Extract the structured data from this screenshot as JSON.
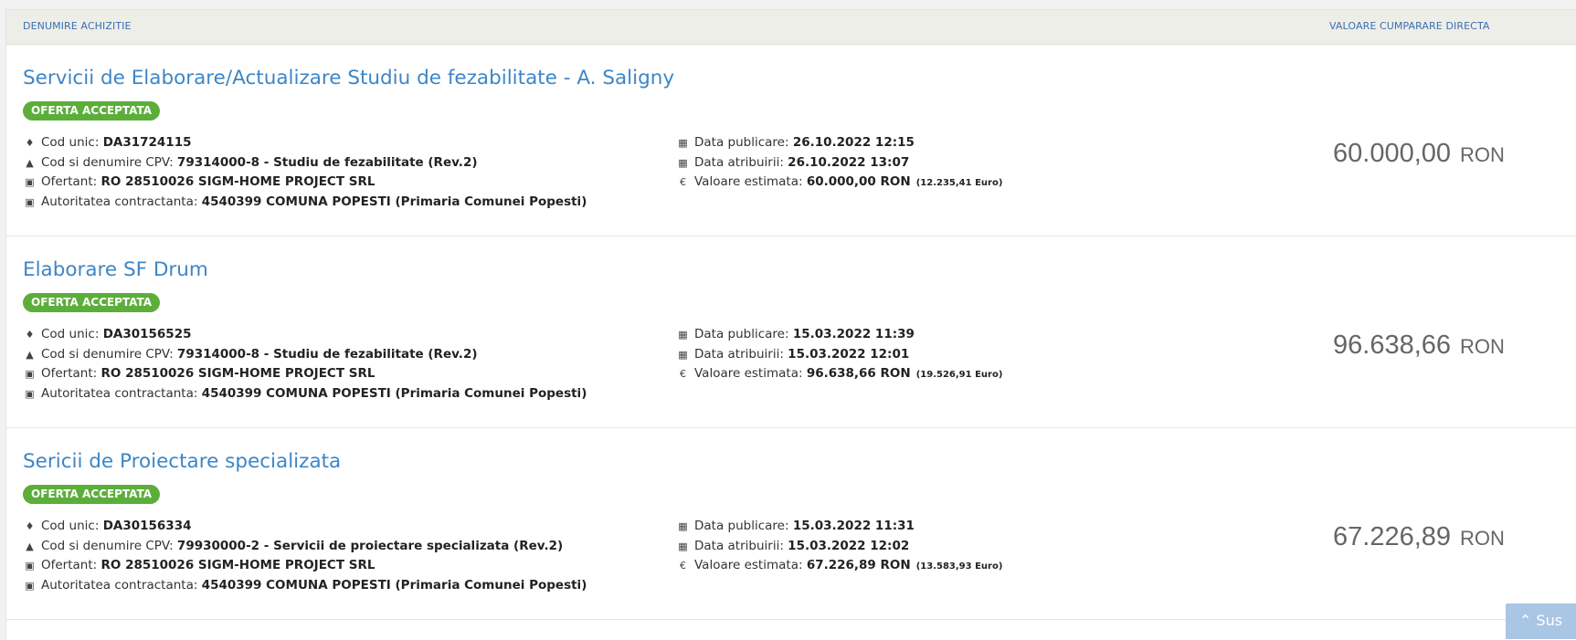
{
  "header": {
    "col_name": "DENUMIRE ACHIZITIE",
    "col_value": "VALOARE CUMPARARE DIRECTA"
  },
  "labels": {
    "cod_unic": "Cod unic:",
    "cpv": "Cod si denumire CPV:",
    "ofertant": "Ofertant:",
    "autoritate": "Autoritatea contractanta:",
    "data_publicare": "Data publicare:",
    "data_atribuirii": "Data atribuirii:",
    "valoare_estimata": "Valoare estimata:",
    "euro": "Euro"
  },
  "items": [
    {
      "title": "Servicii de Elaborare/Actualizare Studiu de fezabilitate - A. Saligny",
      "status": "OFERTA ACCEPTATA",
      "cod_unic": "DA31724115",
      "cpv": "79314000-8 - Studiu de fezabilitate (Rev.2)",
      "ofertant": "RO 28510026 SIGM-HOME PROJECT SRL",
      "autoritate": "4540399 COMUNA POPESTI (Primaria Comunei Popesti)",
      "data_publicare": "26.10.2022 12:15",
      "data_atribuirii": "26.10.2022 13:07",
      "valoare_estimata": "60.000,00  RON",
      "valoare_euro": "(12.235,41",
      "price": "60.000,00",
      "currency": "RON"
    },
    {
      "title": "Elaborare SF Drum",
      "status": "OFERTA ACCEPTATA",
      "cod_unic": "DA30156525",
      "cpv": "79314000-8 - Studiu de fezabilitate (Rev.2)",
      "ofertant": "RO 28510026 SIGM-HOME PROJECT SRL",
      "autoritate": "4540399 COMUNA POPESTI (Primaria Comunei Popesti)",
      "data_publicare": "15.03.2022 11:39",
      "data_atribuirii": "15.03.2022 12:01",
      "valoare_estimata": "96.638,66  RON",
      "valoare_euro": "(19.526,91",
      "price": "96.638,66",
      "currency": "RON"
    },
    {
      "title": "Sericii de Proiectare specializata",
      "status": "OFERTA ACCEPTATA",
      "cod_unic": "DA30156334",
      "cpv": "79930000-2 - Servicii de proiectare specializata (Rev.2)",
      "ofertant": "RO 28510026 SIGM-HOME PROJECT SRL",
      "autoritate": "4540399 COMUNA POPESTI (Primaria Comunei Popesti)",
      "data_publicare": "15.03.2022 11:31",
      "data_atribuirii": "15.03.2022 12:02",
      "valoare_estimata": "67.226,89  RON",
      "valoare_euro": "(13.583,93",
      "price": "67.226,89",
      "currency": "RON"
    }
  ],
  "scroll_top": {
    "label": "Sus"
  },
  "colors": {
    "accent": "#3d86c6",
    "badge": "#5cae3a",
    "header_bg": "#eeeee8"
  }
}
